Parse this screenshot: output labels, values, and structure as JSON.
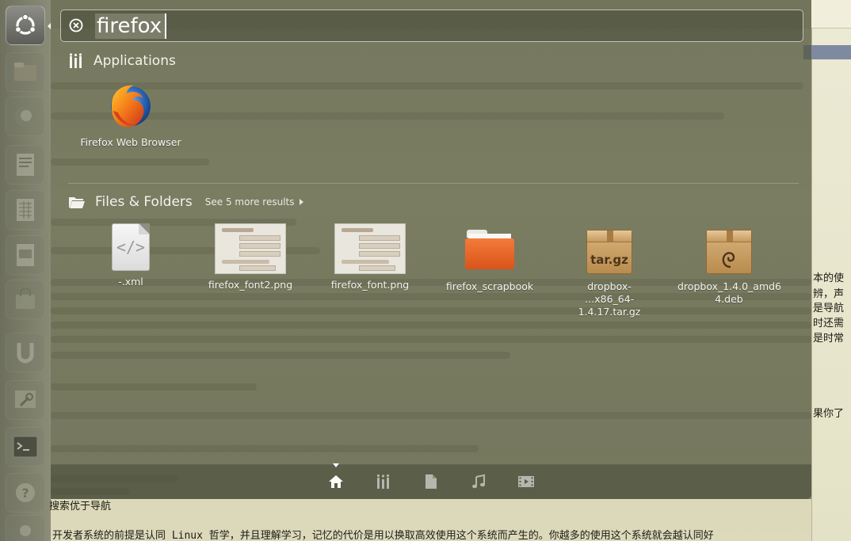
{
  "search": {
    "query": "firefox"
  },
  "applications": {
    "header": "Applications",
    "items": [
      {
        "name": "Firefox Web Browser",
        "icon": "firefox-icon"
      }
    ]
  },
  "files": {
    "header": "Files & Folders",
    "see_more": "See 5 more results",
    "items": [
      {
        "name": "-.xml",
        "icon": "xml-file-icon"
      },
      {
        "name": "firefox_font2.png",
        "icon": "image-thumbnail"
      },
      {
        "name": "firefox_font.png",
        "icon": "image-thumbnail"
      },
      {
        "name": "firefox_scrapbook",
        "icon": "folder-icon"
      },
      {
        "name_line1": "dropbox-",
        "name_line2": "…x86_64-1.4.17.tar.gz",
        "icon": "tar-archive-icon",
        "badge": "tar.gz"
      },
      {
        "name_line1": "dropbox_1.4.0_amd6",
        "name_line2": "4.deb",
        "icon": "debian-package-icon"
      }
    ]
  },
  "lenses": [
    {
      "name": "home-lens",
      "active": true
    },
    {
      "name": "applications-lens",
      "active": false
    },
    {
      "name": "files-lens",
      "active": false
    },
    {
      "name": "music-lens",
      "active": false
    },
    {
      "name": "video-lens",
      "active": false
    }
  ],
  "background_document": {
    "edge_lines": [
      "本的使",
      "辨，声",
      "是导航",
      "时还需",
      "是时常"
    ],
    "edge_line_lower": "果你了",
    "line_nav": "搜索优于导航",
    "line_long": "开发者系统的前提是认同 Linux 哲学，并且理解学习，记忆的代价是用以换取高效使用这个系统而产生的。你越多的使用这个系统就会越认同好"
  },
  "colors": {
    "dash_tint": "#545840",
    "firefox_orange": "#e66000",
    "folder_orange": "#f47b3a",
    "archive_tan": "#c9a064"
  }
}
